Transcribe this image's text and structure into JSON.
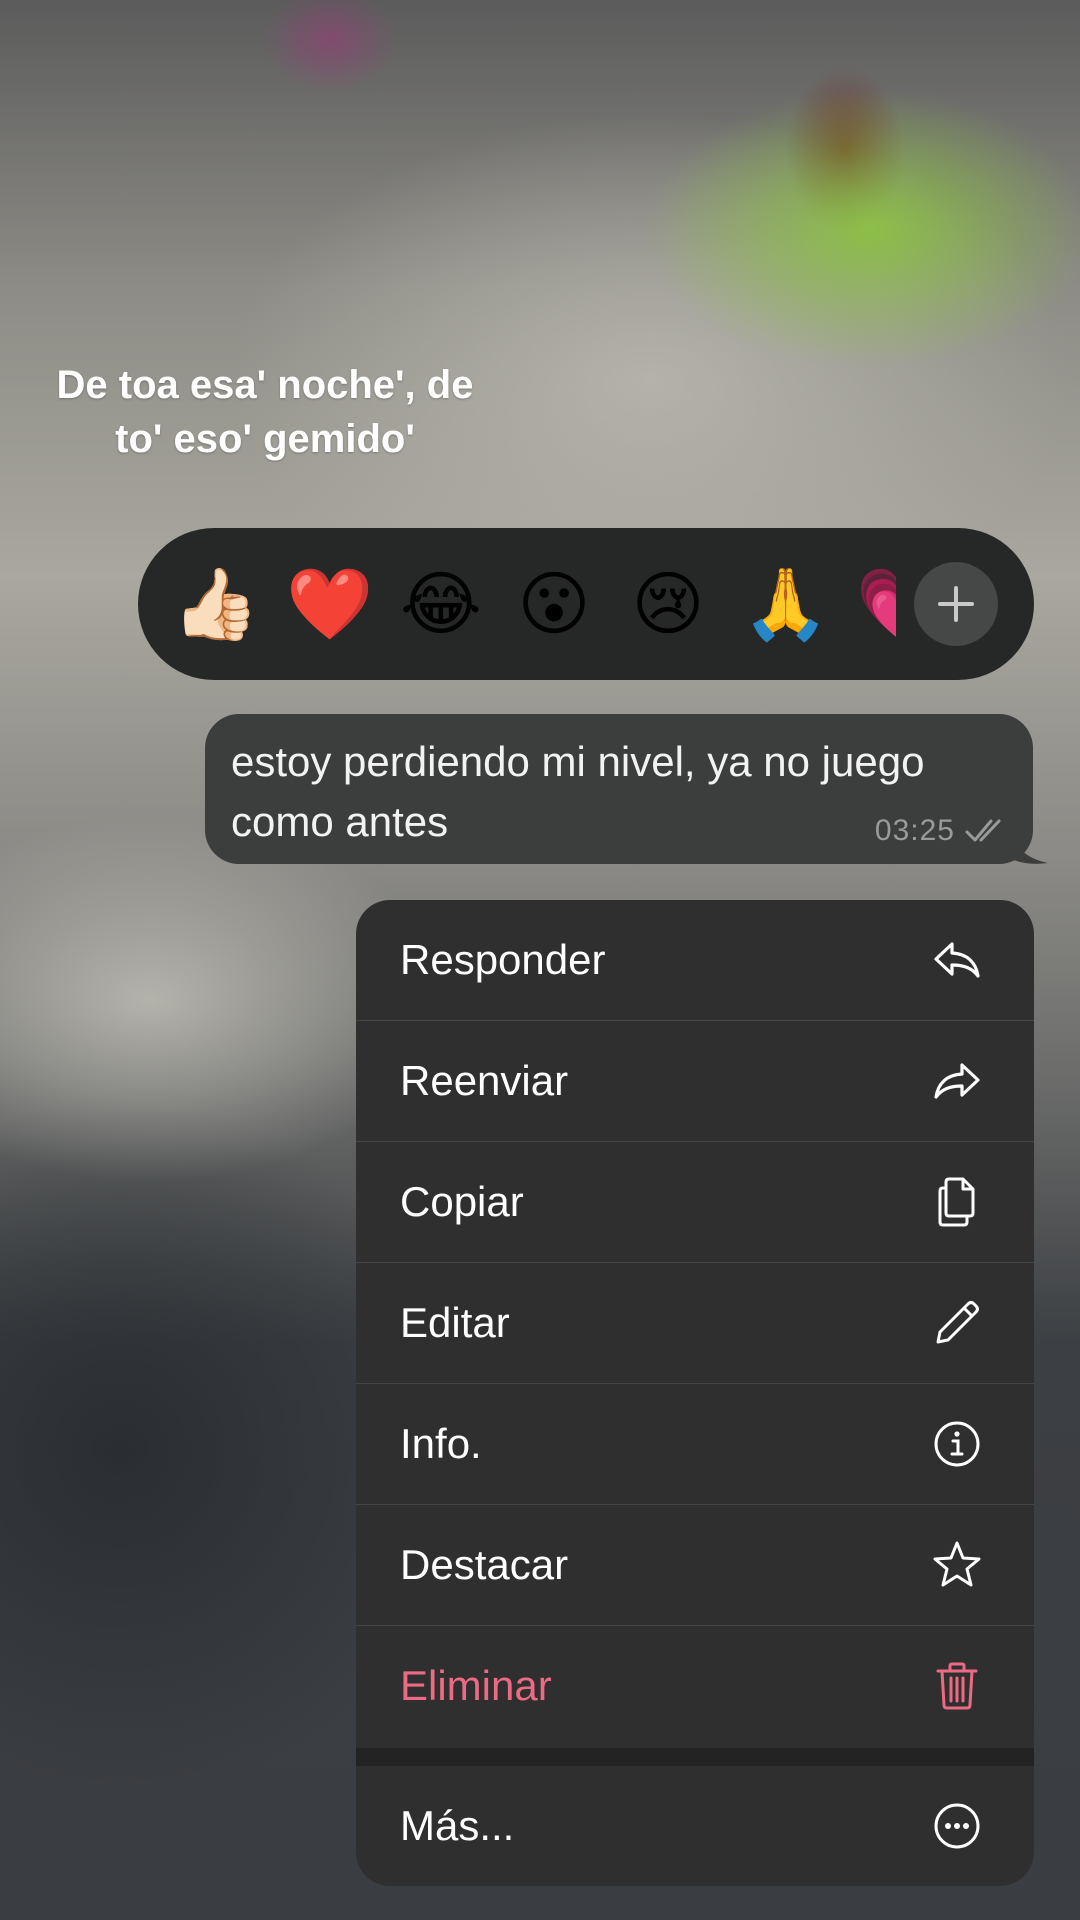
{
  "caption": {
    "line1": "De toa esa' noche', de",
    "line2": "to' eso' gemido'"
  },
  "reactions": {
    "emojis": [
      "👍🏻",
      "❤️",
      "😂",
      "😮",
      "😢",
      "🙏",
      "💗"
    ],
    "more_icon": "plus-icon"
  },
  "message": {
    "text": "estoy perdiendo mi nivel, ya no juego como antes",
    "time": "03:25",
    "status_icon": "double-check-icon"
  },
  "menu": {
    "items": [
      {
        "label": "Responder",
        "icon": "reply-icon"
      },
      {
        "label": "Reenviar",
        "icon": "forward-icon"
      },
      {
        "label": "Copiar",
        "icon": "copy-icon"
      },
      {
        "label": "Editar",
        "icon": "pencil-icon"
      },
      {
        "label": "Info.",
        "icon": "info-icon"
      },
      {
        "label": "Destacar",
        "icon": "star-icon"
      },
      {
        "label": "Eliminar",
        "icon": "trash-icon"
      }
    ],
    "more": {
      "label": "Más...",
      "icon": "more-icon"
    }
  },
  "colors": {
    "danger": "#eb6b84",
    "menu_background": "#2f2f30",
    "bubble_background": "#3c3d3d"
  }
}
